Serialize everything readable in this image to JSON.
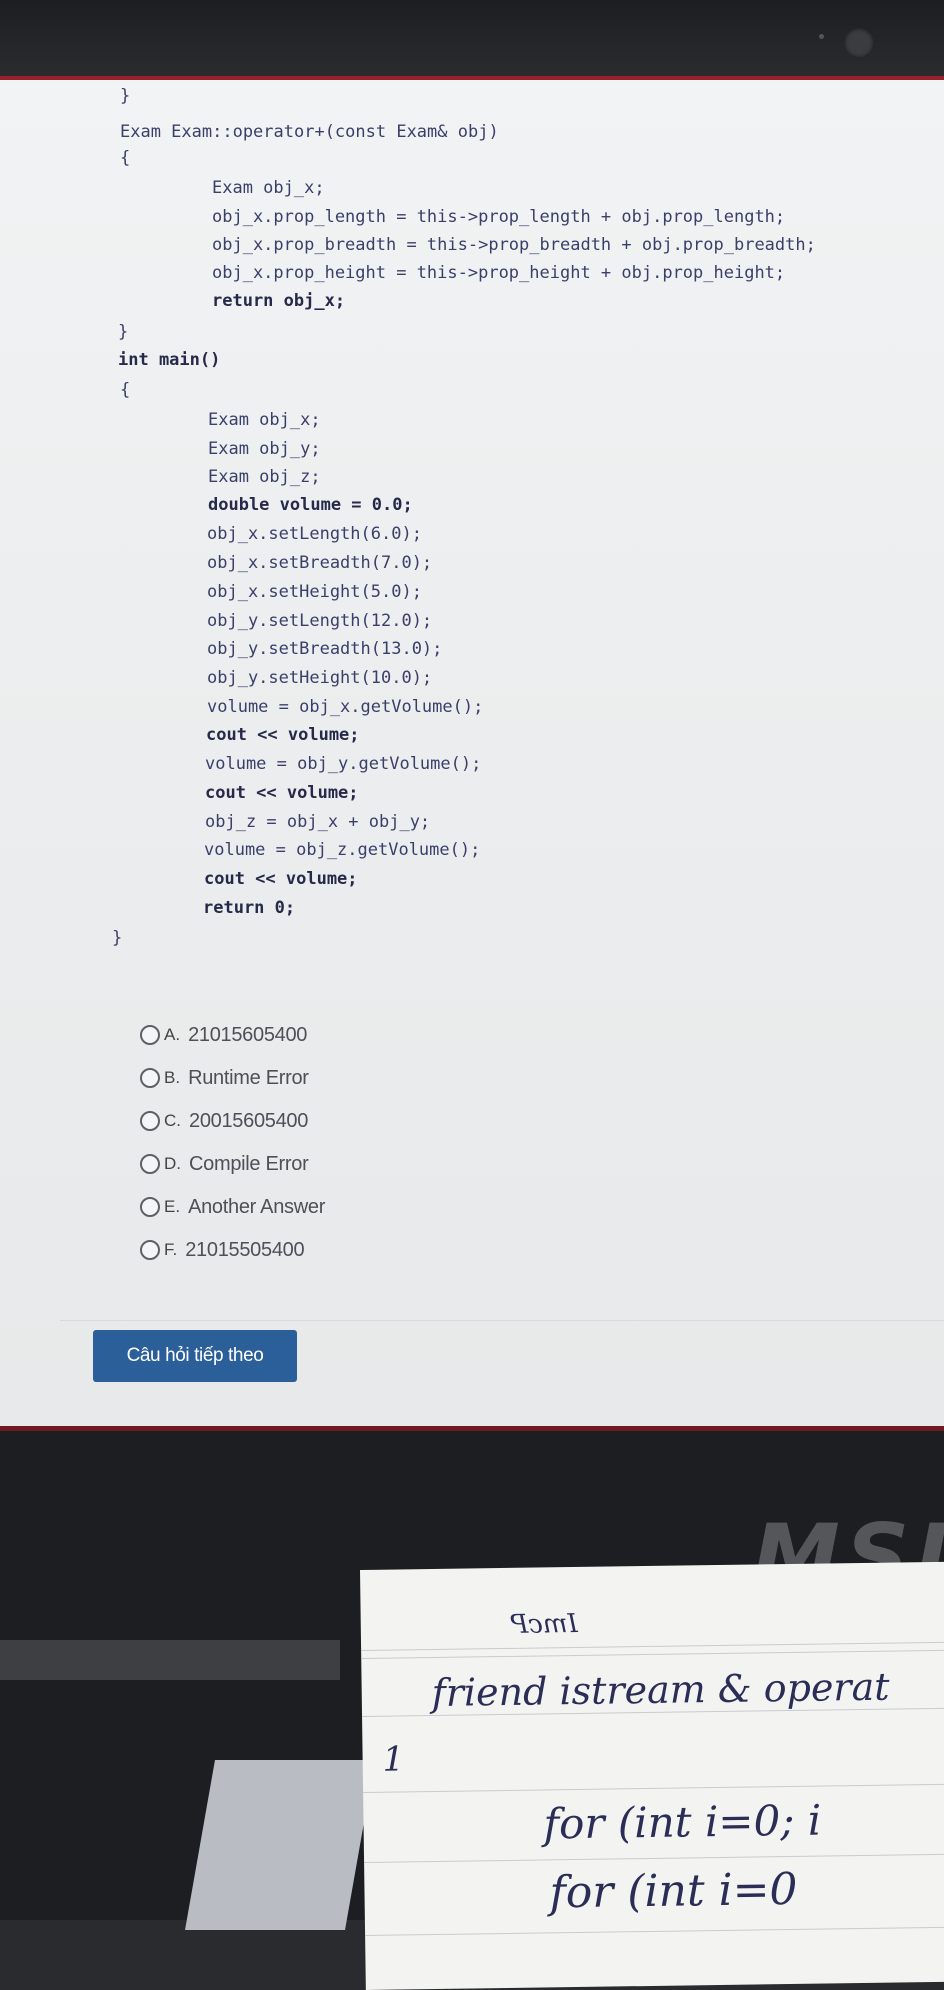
{
  "code": {
    "lines": [
      "}",
      "Exam Exam::operator+(const Exam& obj)",
      "{",
      "Exam obj_x;",
      "obj_x.prop_length = this->prop_length + obj.prop_length;",
      "obj_x.prop_breadth = this->prop_breadth + obj.prop_breadth;",
      "obj_x.prop_height = this->prop_height + obj.prop_height;",
      "return obj_x;",
      "}",
      "int main()",
      "{",
      "Exam obj_x;",
      "Exam obj_y;",
      "Exam obj_z;",
      "double volume = 0.0;",
      "obj_x.setLength(6.0);",
      "obj_x.setBreadth(7.0);",
      "obj_x.setHeight(5.0);",
      "obj_y.setLength(12.0);",
      "obj_y.setBreadth(13.0);",
      "obj_y.setHeight(10.0);",
      "volume = obj_x.getVolume();",
      "cout << volume;",
      "volume = obj_y.getVolume();",
      "cout << volume;",
      "obj_z = obj_x + obj_y;",
      "volume = obj_z.getVolume();",
      "cout << volume;",
      "return 0;",
      "}"
    ]
  },
  "options": [
    {
      "letter": "A.",
      "text": "21015605400"
    },
    {
      "letter": "B.",
      "text": "Runtime Error"
    },
    {
      "letter": "C.",
      "text": "20015605400"
    },
    {
      "letter": "D.",
      "text": "Compile Error"
    },
    {
      "letter": "E.",
      "text": "Another Answer"
    },
    {
      "letter": "F.",
      "text": "21015505400"
    }
  ],
  "next_button": {
    "label": "Câu hỏi tiếp theo"
  },
  "laptop": {
    "brand": "MSI"
  },
  "note": {
    "title": "ImcP",
    "lines": [
      "friend istream & operat",
      "1",
      "for (int i=0; i",
      "for (int i=0"
    ]
  },
  "colors": {
    "button": "#2a5f99",
    "screen_border": "#9a1f2c"
  }
}
